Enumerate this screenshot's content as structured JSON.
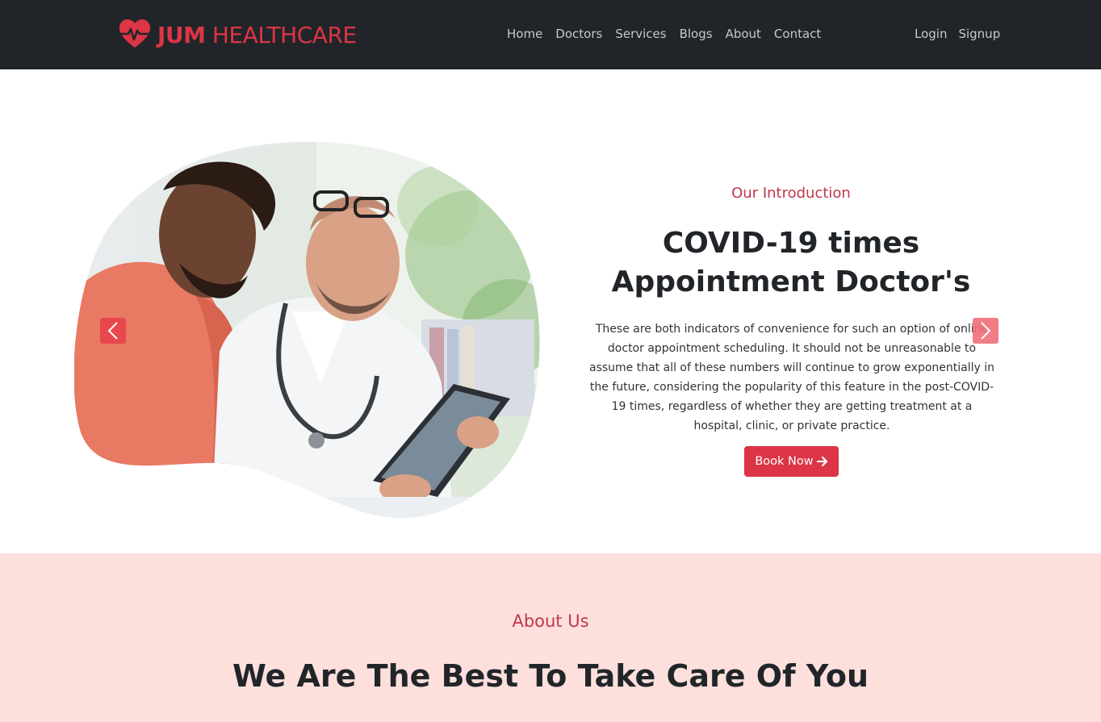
{
  "brand": {
    "bold": "JUM",
    "light": " HEALTHCARE",
    "icon": "heart-pulse-icon",
    "color": "#dc3545"
  },
  "nav": {
    "links": [
      "Home",
      "Doctors",
      "Services",
      "Blogs",
      "About",
      "Contact"
    ],
    "auth": [
      "Login",
      "Signup"
    ]
  },
  "hero": {
    "label": "Our Introduction",
    "title_line1": "COVID-19 times",
    "title_line2": "Appointment Doctor's",
    "text": "These are both indicators of convenience for such an option of online doctor appointment scheduling. It should not be unreasonable to assume that all of these numbers will continue to grow exponentially in the future, considering the popularity of this feature in the post-COVID-19 times, regardless of whether they are getting treatment at a hospital, clinic, or private practice.",
    "button": "Book Now",
    "button_icon": "arrow-right-icon",
    "prev_icon": "chevron-left-icon",
    "next_icon": "chevron-right-icon"
  },
  "about": {
    "label": "About Us",
    "title": "We Are The Best To Take Care Of You"
  },
  "colors": {
    "accent": "#dc3545",
    "nav_bg": "#212529",
    "about_bg": "#fde0dc"
  }
}
